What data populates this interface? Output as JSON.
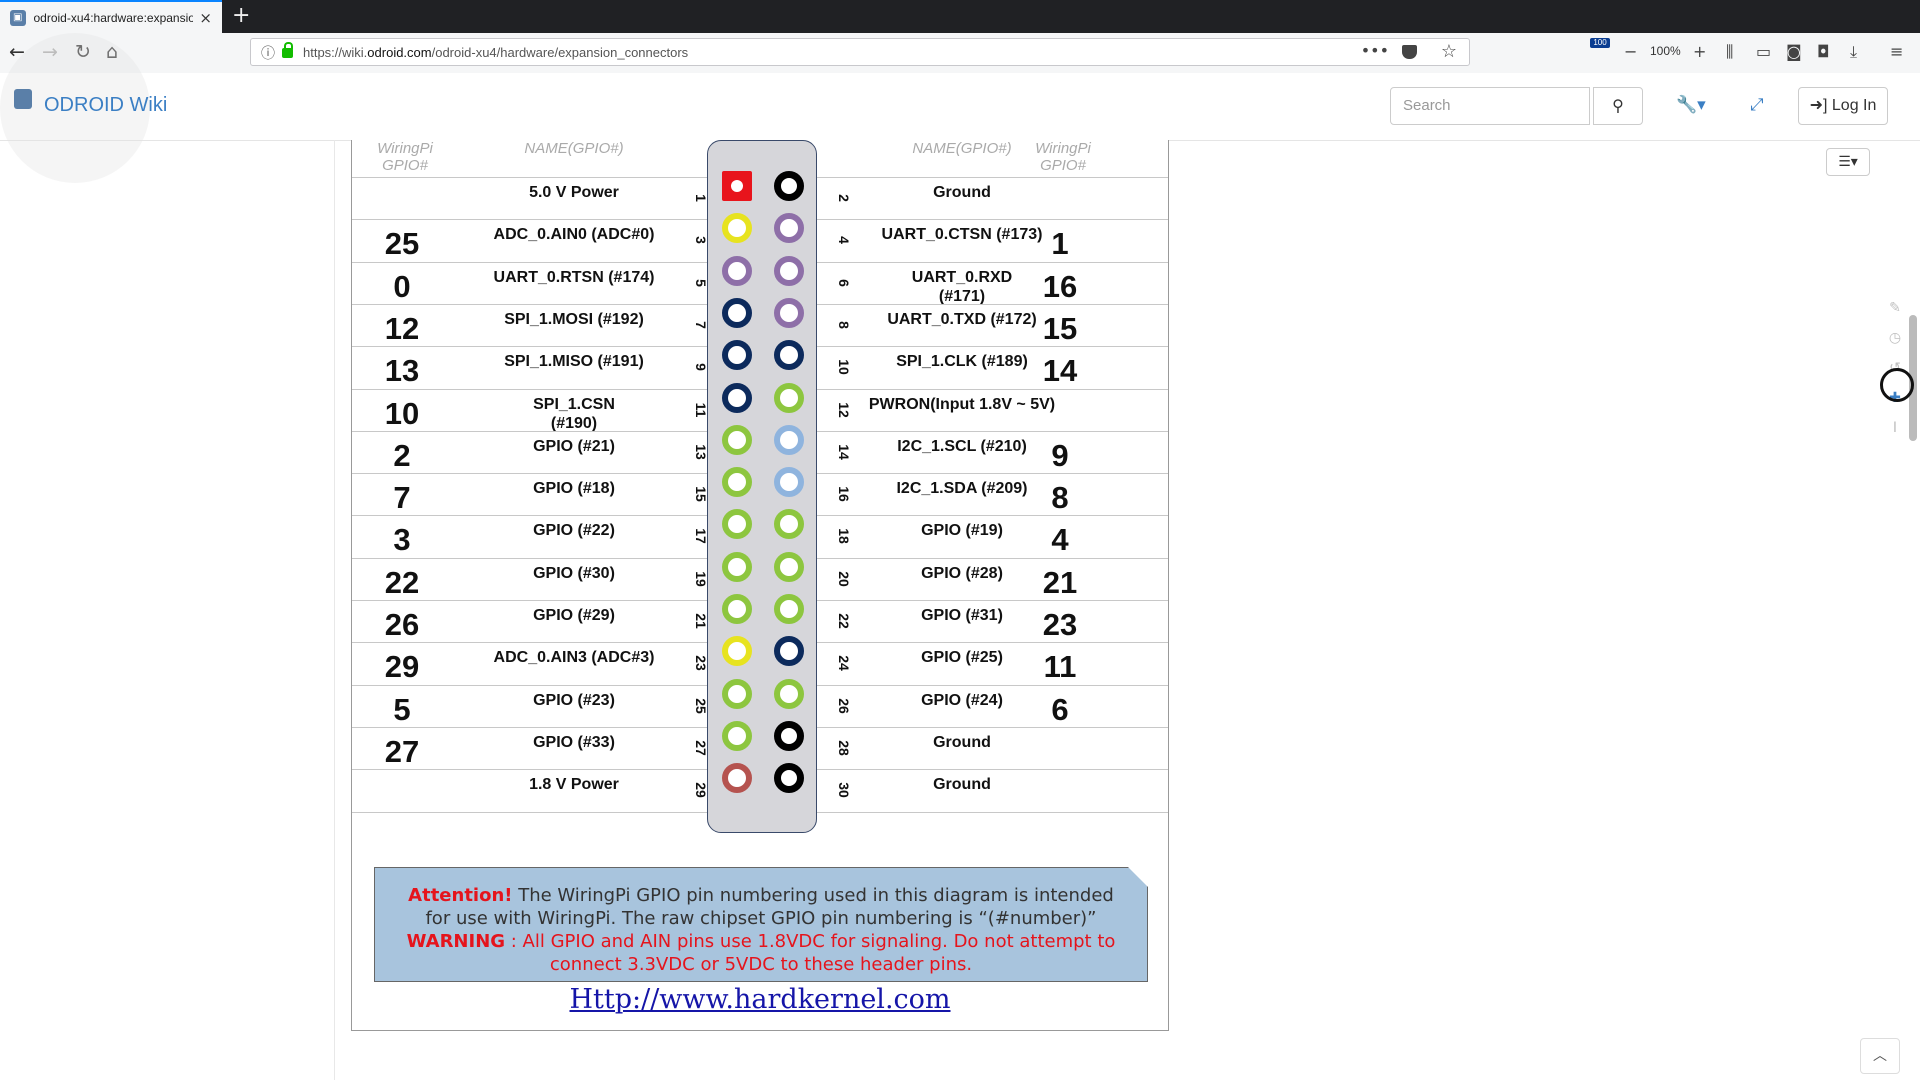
{
  "browser": {
    "tab_title": "odroid-xu4:hardware:expansio",
    "url_prefix": "https://wiki.",
    "url_domain": "odroid.com",
    "url_path": "/odroid-xu4/hardware/expansion_connectors",
    "zoom": "100%",
    "badge": "100"
  },
  "wiki": {
    "brand": "ODROID Wiki",
    "search_placeholder": "Search",
    "login_label": "Log In"
  },
  "diagram": {
    "headers": {
      "left_wiringpi": "WiringPi\nGPIO#",
      "left_name": "NAME(GPIO#)",
      "right_name": "NAME(GPIO#)",
      "right_wiringpi": "WiringPi\nGPIO#"
    },
    "rows": [
      {
        "lw": "",
        "ln": "5.0 V Power",
        "lp": "1",
        "rp": "2",
        "rn": "Ground",
        "rw": ""
      },
      {
        "lw": "25",
        "ln": "ADC_0.AIN0 (ADC#0)",
        "lp": "3",
        "rp": "4",
        "rn": "UART_0.CTSN (#173)",
        "rw": "1"
      },
      {
        "lw": "0",
        "ln": "UART_0.RTSN (#174)",
        "lp": "5",
        "rp": "6",
        "rn": "UART_0.RXD\n(#171)",
        "rw": "16"
      },
      {
        "lw": "12",
        "ln": "SPI_1.MOSI (#192)",
        "lp": "7",
        "rp": "8",
        "rn": "UART_0.TXD (#172)",
        "rw": "15"
      },
      {
        "lw": "13",
        "ln": "SPI_1.MISO (#191)",
        "lp": "9",
        "rp": "10",
        "rn": "SPI_1.CLK (#189)",
        "rw": "14"
      },
      {
        "lw": "10",
        "ln": "SPI_1.CSN\n(#190)",
        "lp": "11",
        "rp": "12",
        "rn": "PWRON(Input 1.8V ~ 5V)",
        "rw": ""
      },
      {
        "lw": "2",
        "ln": "GPIO (#21)",
        "lp": "13",
        "rp": "14",
        "rn": "I2C_1.SCL (#210)",
        "rw": "9"
      },
      {
        "lw": "7",
        "ln": "GPIO (#18)",
        "lp": "15",
        "rp": "16",
        "rn": "I2C_1.SDA (#209)",
        "rw": "8"
      },
      {
        "lw": "3",
        "ln": "GPIO (#22)",
        "lp": "17",
        "rp": "18",
        "rn": "GPIO (#19)",
        "rw": "4"
      },
      {
        "lw": "22",
        "ln": "GPIO (#30)",
        "lp": "19",
        "rp": "20",
        "rn": "GPIO (#28)",
        "rw": "21"
      },
      {
        "lw": "26",
        "ln": "GPIO (#29)",
        "lp": "21",
        "rp": "22",
        "rn": "GPIO (#31)",
        "rw": "23"
      },
      {
        "lw": "29",
        "ln": "ADC_0.AIN3 (ADC#3)",
        "lp": "23",
        "rp": "24",
        "rn": "GPIO (#25)",
        "rw": "11"
      },
      {
        "lw": "5",
        "ln": "GPIO (#23)",
        "lp": "25",
        "rp": "26",
        "rn": "GPIO (#24)",
        "rw": "6"
      },
      {
        "lw": "27",
        "ln": "GPIO (#33)",
        "lp": "27",
        "rp": "28",
        "rn": "Ground",
        "rw": ""
      },
      {
        "lw": "",
        "ln": "1.8 V Power",
        "lp": "29",
        "rp": "30",
        "rn": "Ground",
        "rw": ""
      }
    ],
    "pin_colors": {
      "left": [
        "red-square",
        "#e7e31f",
        "#8e6fa8",
        "#0c2a5c",
        "#0c2a5c",
        "#0c2a5c",
        "#8dc63f",
        "#8dc63f",
        "#8dc63f",
        "#8dc63f",
        "#8dc63f",
        "#e7e31f",
        "#8dc63f",
        "#8dc63f",
        "#b5534f"
      ],
      "right": [
        "#000000",
        "#8e6fa8",
        "#8e6fa8",
        "#8e6fa8",
        "#0c2a5c",
        "#8dc63f",
        "#8fb4de",
        "#8fb4de",
        "#8dc63f",
        "#8dc63f",
        "#8dc63f",
        "#0c2a5c",
        "#8dc63f",
        "#000000",
        "#000000"
      ]
    },
    "attention_label": "Attention!",
    "attention_text": " The WiringPi GPIO pin numbering used in this diagram is intended for use with WiringPi. The raw chipset GPIO pin numbering is “(#number)”",
    "warning_label": "WARNING",
    "warning_text": " : All GPIO and AIN pins use 1.8VDC for signaling. Do not attempt to connect 3.3VDC or 5VDC to these header pins.",
    "link": "Http://www.hardkernel.com"
  }
}
